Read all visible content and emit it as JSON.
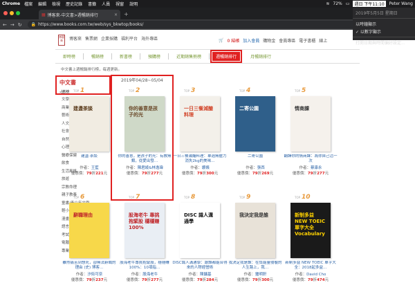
{
  "menubar": {
    "app": "Chrome",
    "items": [
      "檔案",
      "編輯",
      "檢視",
      "歷史記錄",
      "書籤",
      "人員",
      "視窗",
      "說明"
    ],
    "battery": "72%",
    "clock": "週日 下午11:10",
    "user": "Peter Wang"
  },
  "clock_menu": {
    "date": "2019年5月5日 星期日",
    "opt1": "以時鐘顯示",
    "opt2": "✓ 以數字顯示",
    "opt3": "打開日期與時間偏好設定..."
  },
  "browser": {
    "tab_title": "博客來-中文書>週暢銷排行",
    "url": "https://www.books.com.tw/web/sys_bkwtop/books/"
  },
  "site": {
    "logo": "博客來",
    "topnav": [
      "博客來",
      "售票網",
      "企業採購",
      "福利平台",
      "海外專區"
    ],
    "cart": "0 結帳",
    "rightnav": [
      "加入會員",
      "購物金",
      "會員專區",
      "電子書櫃",
      "線上"
    ],
    "subnav": [
      "即時榜",
      "暢銷榜",
      "新書榜",
      "預購榜",
      "近期銷售熱榜",
      "週暢銷排行",
      "月暢銷排行"
    ],
    "active_subnav": "週暢銷排行",
    "breadcrumb": "中文書上週暢銷排行榜",
    "update_note": "，每週更新。",
    "date_range": "2019年04/28~05/04"
  },
  "sidebar": {
    "heading": "中文書",
    "selected": "›總榜",
    "items": [
      "文學小說",
      "商業理財",
      "藝術設計",
      "人文史地",
      "社會科學",
      "自然科普",
      "心理勵志",
      "醫療保健",
      "飲食",
      "生活風格",
      "旅遊",
      "宗教命理",
      "親子教養",
      "童書/青少年文學",
      "輕小說",
      "漫畫",
      "語言學習",
      "考試用書",
      "電腦資訊",
      "專業/教科書/政府出版品"
    ]
  },
  "books": [
    {
      "rank_label": "TOP",
      "rank": "1",
      "title": "建盞‧茶談",
      "author_label": "作者：",
      "author": "王藍",
      "price_label": "優惠價：",
      "discount": "79",
      "price": "221",
      "unit": "元",
      "cover_text": "建盞茶談"
    },
    {
      "rank_label": "TOP",
      "rank": "2",
      "title": "你的善意，是孩子的光：有教無類，從愛出發…",
      "author_label": "作者：",
      "author": "陳君綾&林逸瑋",
      "price_label": "優惠價：",
      "discount": "79",
      "price": "277",
      "unit": "元",
      "cover_text": "你的善意是孩子的光"
    },
    {
      "rank_label": "TOP",
      "rank": "3",
      "title": "一日三餐減醣料理：單週無壓力消失2kg的美味…",
      "author_label": "作者：",
      "author": "娜姨",
      "price_label": "優惠價：",
      "discount": "79",
      "price": "300",
      "unit": "元",
      "cover_text": "一日三餐減醣料理"
    },
    {
      "rank_label": "TOP",
      "rank": "4",
      "title": "二寄公園",
      "author_label": "作者：",
      "author": "張西",
      "price_label": "優惠價：",
      "discount": "79",
      "price": "269",
      "unit": "元",
      "cover_text": "二寄公園"
    },
    {
      "rank_label": "TOP",
      "rank": "5",
      "title": "翻譯你的情商課：為你自己活一次",
      "author_label": "作者：",
      "author": "蔡康永",
      "price_label": "優惠價：",
      "discount": "79",
      "price": "277",
      "unit": "元",
      "cover_text": "情商課"
    },
    {
      "rank_label": "TOP",
      "rank": "6",
      "title": "雖然痛苦到想死，卻無法辭職的理由 (史) 博客…",
      "author_label": "作者：",
      "author": "汐街可奈",
      "price_label": "優惠價：",
      "discount": "79",
      "price": "237",
      "unit": "元",
      "cover_text": "辭職理由"
    },
    {
      "rank_label": "TOP",
      "rank": "7",
      "title": "股海老牛專挑抱緊股，穩穩賺100%：10項指…",
      "author_label": "作者：",
      "author": "股海老牛",
      "price_label": "優惠價：",
      "discount": "79",
      "price": "277",
      "unit": "元",
      "cover_text": "股海老牛 專挑抱緊股 穩穩賺100%"
    },
    {
      "rank_label": "TOP",
      "rank": "8",
      "title": "DISC識人溝通學：跟誰都能合得來的人際經營術",
      "author_label": "作者：",
      "author": "陳鏞基",
      "price_label": "優惠價：",
      "discount": "79",
      "price": "284",
      "unit": "元",
      "cover_text": "DISC 識人溝通學"
    },
    {
      "rank_label": "TOP",
      "rank": "9",
      "title": "我決定我是誰：在負能量侵襲的人生路上，我…",
      "author_label": "作者：",
      "author": "鍾明軒",
      "price_label": "優惠價：",
      "discount": "79",
      "price": "300",
      "unit": "元",
      "cover_text": "我決定我是誰"
    },
    {
      "rank_label": "TOP",
      "rank": "10",
      "title": "新制多益 NEW TOEIC 單字大全：2018起多益…",
      "author_label": "作者：",
      "author": "David Cho",
      "price_label": "優惠價：",
      "discount": "79",
      "price": "474",
      "unit": "元",
      "cover_text": "新制多益 NEW TOEIC 單字大全 Vocabulary"
    }
  ],
  "colors": {
    "accent": "#e02020",
    "link": "#2a62a6",
    "rank": "#e89a3c",
    "subnav": "#7a9a38"
  }
}
